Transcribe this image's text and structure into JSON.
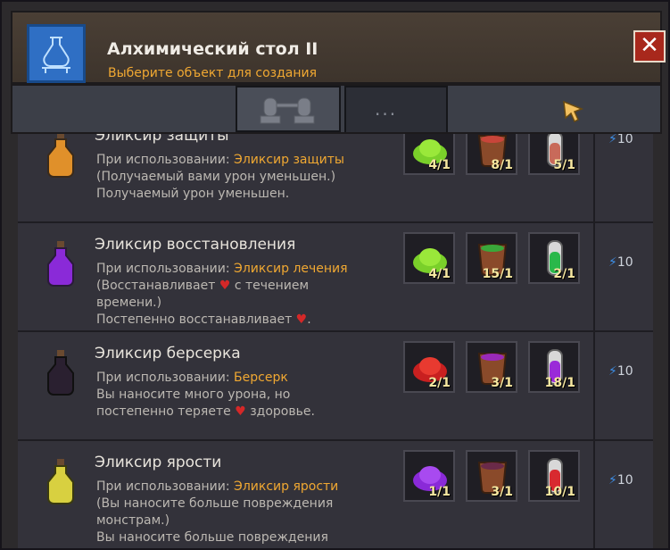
{
  "window": {
    "title": "Алхимический стол II",
    "subtitle": "Выберите объект для создания",
    "close_label": "✕"
  },
  "tabs": [
    {
      "name": "tab-alchemy",
      "label": ""
    },
    {
      "name": "tab-more",
      "label": "···"
    }
  ],
  "colors": {
    "accent": "#f0a832",
    "heart": "#d42828",
    "bolt": "#3d8fe8",
    "count": "#f6e7a0"
  },
  "recipes": [
    {
      "name": "Эликсир защиты",
      "use_prefix": "При использовании: ",
      "use_item": "Эликсир защиты",
      "line2": "(Получаемый вами урон уменьшен.)",
      "line3": "Получаемый урон уменьшен.",
      "ingredients": [
        {
          "icon": "green-powder-icon",
          "count": "4/1"
        },
        {
          "icon": "red-liquid-pot-icon",
          "count": "8/1"
        },
        {
          "icon": "red-tube-icon",
          "count": "5/1"
        }
      ],
      "cost": "10",
      "potion": "orange-potion-icon",
      "potion_color": "#e0902a"
    },
    {
      "name": "Эликсир восстановления",
      "use_prefix": "При использовании: ",
      "use_item": "Эликсир лечения",
      "line2a": "(Восстанавливает ",
      "line2b": " с течением",
      "line3": "времени.)",
      "line4a": "Постепенно восстанавливает ",
      "line4b": ".",
      "ingredients": [
        {
          "icon": "green-powder-icon",
          "count": "4/1"
        },
        {
          "icon": "green-liquid-pot-icon",
          "count": "15/1"
        },
        {
          "icon": "green-tube-icon",
          "count": "2/1"
        }
      ],
      "cost": "10",
      "potion": "purple-potion-icon",
      "potion_color": "#8a2ad8"
    },
    {
      "name": "Эликсир берсерка",
      "use_prefix": "При использовании: ",
      "use_item": "Берсерк",
      "line2": "Вы наносите много урона, но",
      "line3a": "постепенно теряете ",
      "line3b": " здоровье.",
      "ingredients": [
        {
          "icon": "red-powder-icon",
          "count": "2/1"
        },
        {
          "icon": "purple-liquid-pot-icon",
          "count": "3/1"
        },
        {
          "icon": "purple-tube-icon",
          "count": "18/1"
        }
      ],
      "cost": "10",
      "potion": "black-potion-icon",
      "potion_color": "#2a2030"
    },
    {
      "name": "Эликсир ярости",
      "use_prefix": "При использовании: ",
      "use_item": "Эликсир ярости",
      "line2": "(Вы наносите больше повреждения",
      "line3": "монстрам.)",
      "line4": "Вы наносите больше повреждения",
      "ingredients": [
        {
          "icon": "purple-powder-icon",
          "count": "1/1"
        },
        {
          "icon": "purple-liquid-pot-icon",
          "count": "3/1"
        },
        {
          "icon": "red-tube-icon",
          "count": "10/1"
        }
      ],
      "cost": "10",
      "potion": "yellow-potion-icon",
      "potion_color": "#d8d040"
    }
  ]
}
